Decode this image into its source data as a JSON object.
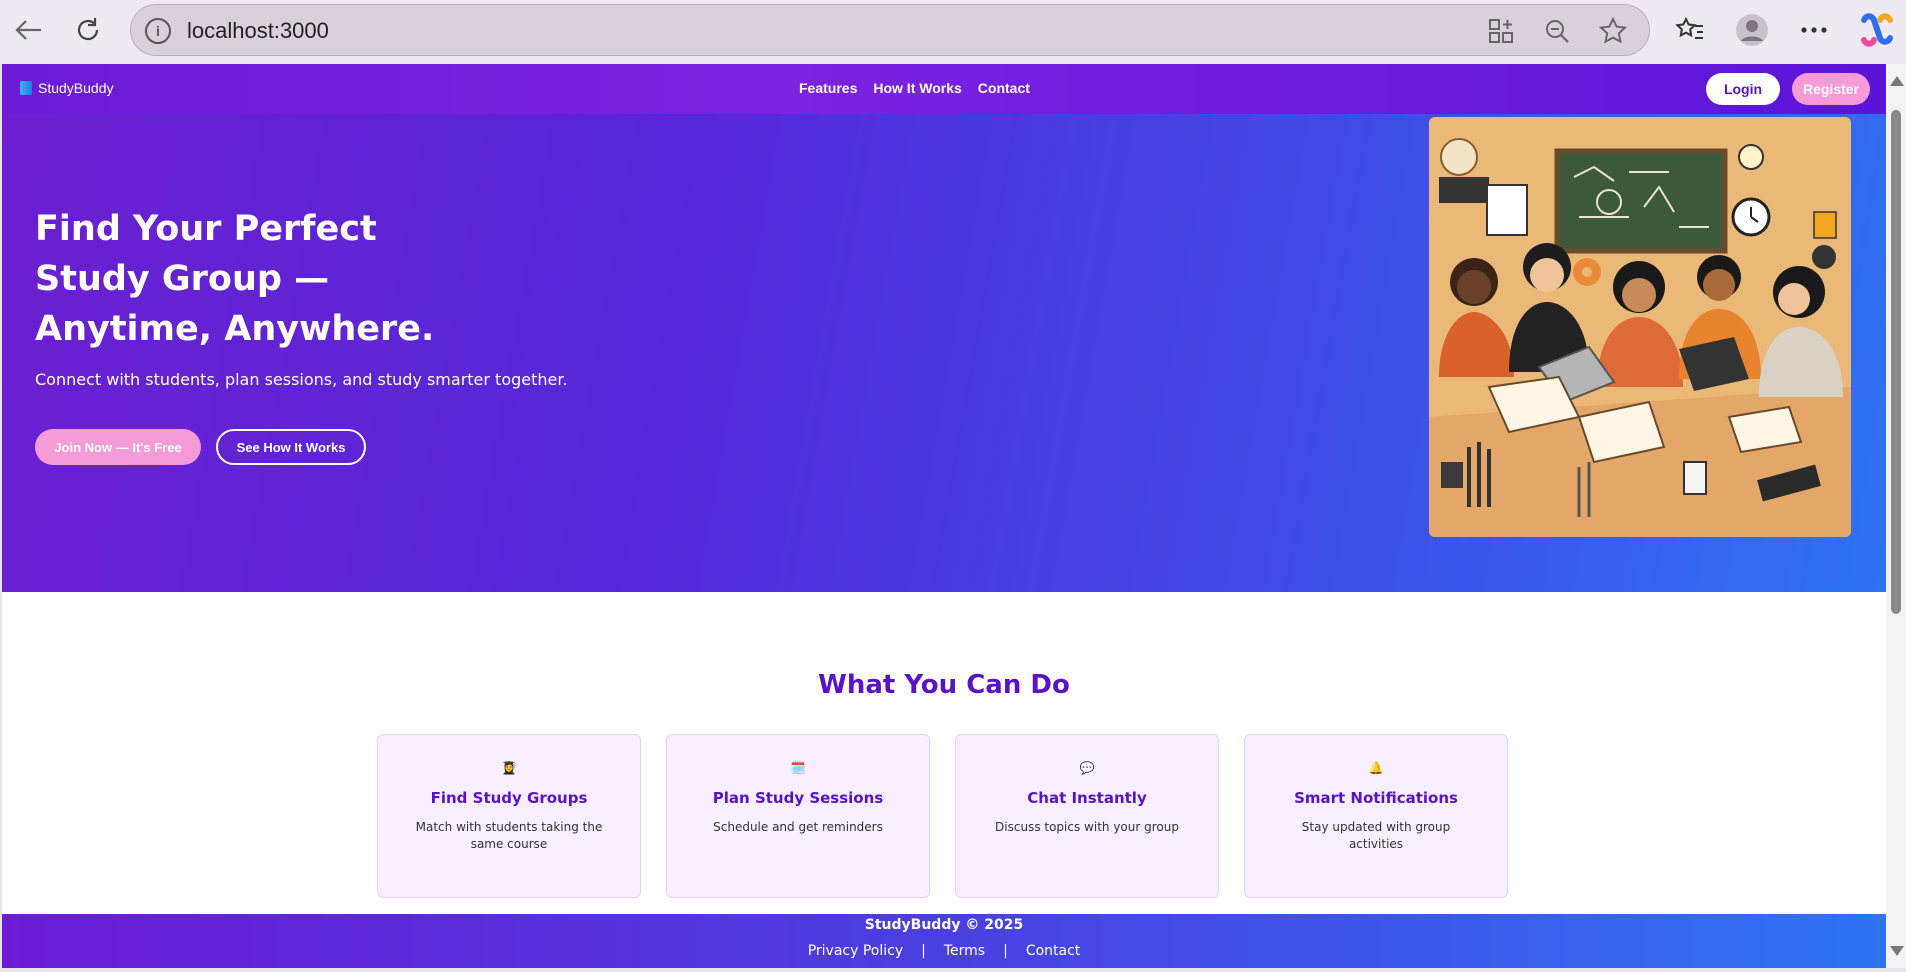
{
  "browser": {
    "url": "localhost:3000",
    "info_glyph": "i"
  },
  "header": {
    "brand": "StudyBuddy",
    "nav": [
      "Features",
      "How It Works",
      "Contact"
    ],
    "login": "Login",
    "register": "Register"
  },
  "hero": {
    "title": "Find Your Perfect Study Group — Anytime, Anywhere.",
    "subtitle": "Connect with students, plan sessions, and study smarter together.",
    "primary_cta": "Join Now — It's Free",
    "secondary_cta": "See How It Works",
    "image_icon": "students-studying-illustration"
  },
  "features": {
    "title": "What You Can Do",
    "cards": [
      {
        "icon": "👩‍🎓",
        "title": "Find Study Groups",
        "desc": "Match with students taking the same course"
      },
      {
        "icon": "🗓️",
        "title": "Plan Study Sessions",
        "desc": "Schedule and get reminders"
      },
      {
        "icon": "💬",
        "title": "Chat Instantly",
        "desc": "Discuss topics with your group"
      },
      {
        "icon": "🔔",
        "title": "Smart Notifications",
        "desc": "Stay updated with group activities"
      }
    ]
  },
  "footer": {
    "copyright": "StudyBuddy © 2025",
    "links": [
      "Privacy Policy",
      "|",
      "Terms",
      "|",
      "Contact"
    ]
  },
  "colors": {
    "brand_purple": "#5a12c9",
    "accent_pink": "#f49bd8",
    "gradient_end_blue": "#2f72f2"
  }
}
